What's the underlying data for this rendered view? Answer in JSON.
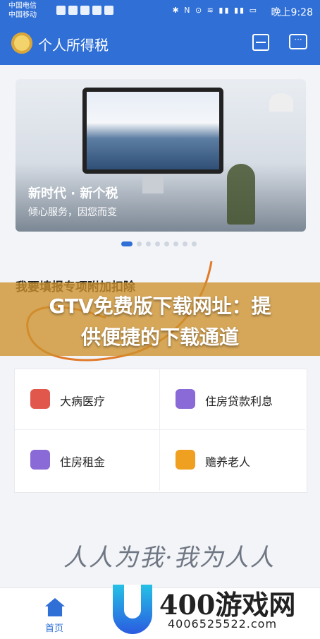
{
  "status": {
    "carrier1": "中国电信",
    "carrier2": "中国移动",
    "time": "晚上9:28",
    "sys": "✱ N ⊙ ≋ ▮▮ ▮▮ ▭"
  },
  "header": {
    "title": "个人所得税"
  },
  "banner": {
    "headline": "新时代 · 新个税",
    "subline": "倾心服务，因您而变",
    "dots": 8,
    "active_dot": 0
  },
  "section": {
    "title": "我要填报专项附加扣除"
  },
  "overlay": {
    "line1": "GTV免费版下载网址：提",
    "line2": "供便捷的下载通道"
  },
  "deductions": [
    {
      "label": "大病医疗",
      "icon": "medical-kit-icon",
      "color": "#e2574c"
    },
    {
      "label": "住房贷款利息",
      "icon": "house-loan-icon",
      "color": "#8a6ad6"
    },
    {
      "label": "住房租金",
      "icon": "house-rent-icon",
      "color": "#8a6ad6"
    },
    {
      "label": "赡养老人",
      "icon": "elder-care-icon",
      "color": "#f0a020"
    }
  ],
  "watermark": {
    "text": "人人为我·我为人人"
  },
  "tabbar": {
    "home_label": "首页"
  },
  "brand": {
    "name": "400游戏网",
    "number": "4006525522.com"
  },
  "colors": {
    "primary": "#2f6fd6",
    "overlay": "#cd912d"
  }
}
